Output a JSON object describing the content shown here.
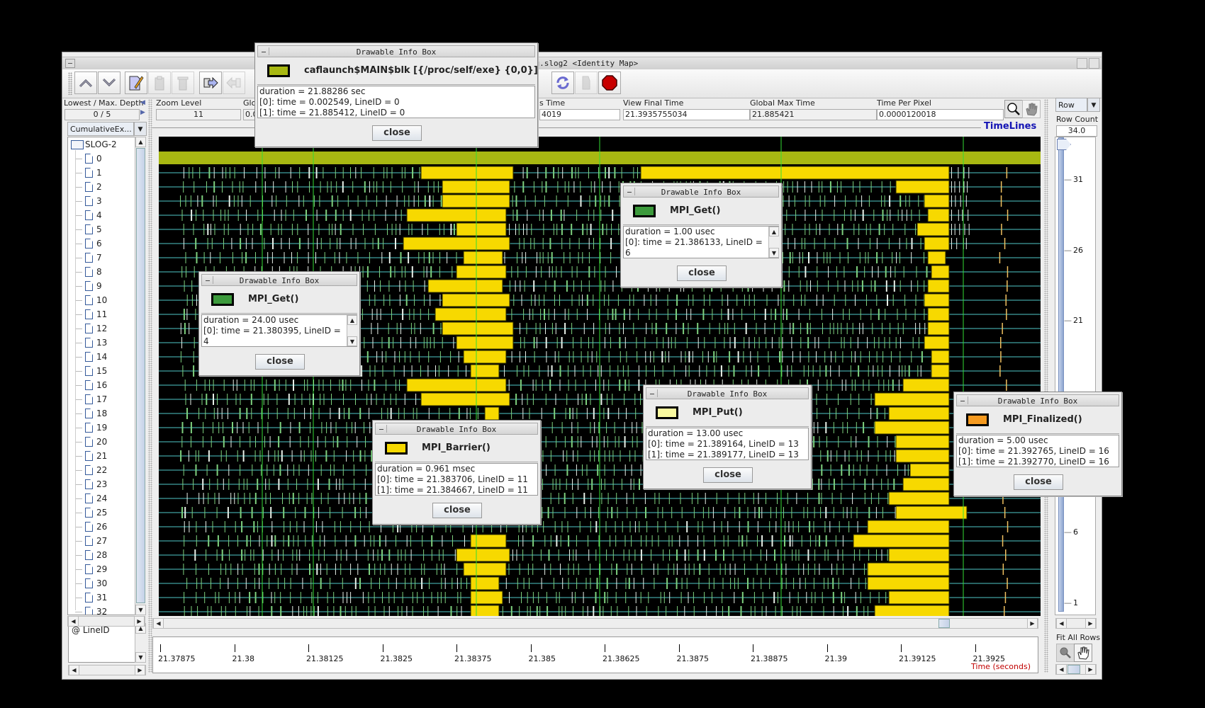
{
  "window": {
    "title_fragment": ": tau.slog2  <Identity Map>"
  },
  "toolbar": {
    "buttons": [
      {
        "icon": "up-chevron-icon",
        "enabled": true
      },
      {
        "icon": "down-chevron-icon",
        "enabled": true
      },
      {
        "icon": "edit-icon",
        "enabled": true
      },
      {
        "icon": "clipboard-icon",
        "enabled": false
      },
      {
        "icon": "trash-icon",
        "enabled": false
      },
      {
        "icon": "export-right-icon",
        "enabled": true
      },
      {
        "icon": "import-left-icon",
        "enabled": false
      },
      {
        "icon": "refresh-icon",
        "enabled": true
      },
      {
        "icon": "print-icon",
        "enabled": false
      },
      {
        "icon": "stop-icon",
        "enabled": true
      }
    ]
  },
  "fields": {
    "depth": {
      "label": "Lowest / Max. Depth",
      "value": "0 / 5"
    },
    "zoom": {
      "label": "Zoom Level",
      "value": "11"
    },
    "global_min": {
      "label": "Glo",
      "value": "0.0"
    },
    "view_init": {
      "label": "s Time",
      "value": "4019"
    },
    "view_final": {
      "label": "View Final Time",
      "value": "21.3935755034"
    },
    "global_max": {
      "label": "Global Max Time",
      "value": "21.885421"
    },
    "time_per_pixel": {
      "label": "Time Per Pixel",
      "value": "0.0000120018"
    }
  },
  "left_panel": {
    "dropdown": "CumulativeEx...",
    "root": "SLOG-2",
    "items": [
      "0",
      "1",
      "2",
      "3",
      "4",
      "5",
      "6",
      "7",
      "8",
      "9",
      "10",
      "11",
      "12",
      "13",
      "14",
      "15",
      "16",
      "17",
      "18",
      "19",
      "20",
      "21",
      "22",
      "23",
      "24",
      "25",
      "26",
      "27",
      "28",
      "29",
      "30",
      "31",
      "32"
    ],
    "bottom_label": "@ LineID"
  },
  "timeline": {
    "title": "TimeLines",
    "axis_label": "Time (seconds)",
    "ticks": [
      "21.37875",
      "21.38",
      "21.38125",
      "21.3825",
      "21.38375",
      "21.385",
      "21.38625",
      "21.3875",
      "21.38875",
      "21.39",
      "21.39125",
      "21.3925"
    ],
    "row_count": 34,
    "colors": {
      "background": "#000000",
      "main_block": "#a8b812",
      "barrier": "#f7d900",
      "mpi_get": "#3c9a3c",
      "row_line": "#4fc8c8",
      "marker": "#33dd33"
    }
  },
  "right_panel": {
    "dropdown": "Row",
    "row_count_label": "Row Count",
    "row_count_value": "34.0",
    "ruler_ticks": [
      "31",
      "26",
      "21",
      "6",
      "1"
    ],
    "fit_label": "Fit All Rows"
  },
  "info_boxes": [
    {
      "title": "Drawable Info Box",
      "name": "caflaunch$MAIN$blk [{/proc/self/exe} {0,0}]",
      "color": "#a8b812",
      "lines": [
        "duration = 21.88286 sec",
        "[0]: time = 0.002549, LineID = 0",
        "[1]: time = 21.885412, LineID = 0"
      ],
      "close": "close"
    },
    {
      "title": "Drawable Info Box",
      "name": "MPI_Get()",
      "color": "#3c9a3c",
      "lines": [
        "duration = 24.00 usec",
        "[0]: time = 21.380395, LineID =",
        "4"
      ],
      "close": "close"
    },
    {
      "title": "Drawable Info Box",
      "name": "MPI_Get()",
      "color": "#3c9a3c",
      "lines": [
        "duration = 1.00 usec",
        "[0]: time = 21.386133, LineID =",
        "6"
      ],
      "close": "close"
    },
    {
      "title": "Drawable Info Box",
      "name": "MPI_Barrier()",
      "color": "#f7d900",
      "lines": [
        "duration = 0.961 msec",
        "[0]: time = 21.383706, LineID = 11",
        "[1]: time = 21.384667, LineID = 11"
      ],
      "close": "close"
    },
    {
      "title": "Drawable Info Box",
      "name": "MPI_Put()",
      "color": "#fafaa0",
      "lines": [
        "duration = 13.00 usec",
        "[0]: time = 21.389164, LineID = 13",
        "[1]: time = 21.389177, LineID = 13"
      ],
      "close": "close"
    },
    {
      "title": "Drawable Info Box",
      "name": "MPI_Finalized()",
      "color": "#f59a20",
      "lines": [
        "duration = 5.00 usec",
        "[0]: time = 21.392765, LineID = 16",
        "[1]: time = 21.392770, LineID = 16"
      ],
      "close": "close"
    }
  ]
}
